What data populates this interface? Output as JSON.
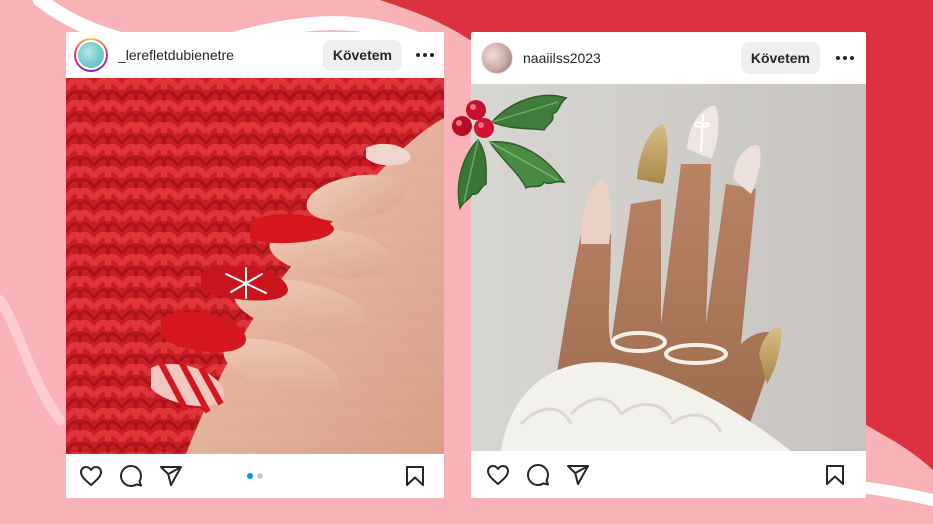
{
  "colors": {
    "background_pink": "#f9b3b8",
    "background_red": "#dc3240",
    "card_white": "#ffffff",
    "text_dark": "#262626",
    "button_gray": "#efefef",
    "dot_active": "#0095f6",
    "dot_inactive": "#c8c8c8"
  },
  "posts": [
    {
      "username": "_lerefletdubienetre",
      "follow_label": "Követem",
      "more_icon": "more-horizontal-icon",
      "image_subject": "red-nails-on-red-knit",
      "actions": [
        "heart-icon",
        "comment-icon",
        "share-icon",
        "bookmark-icon"
      ],
      "carousel": {
        "total": 2,
        "active": 1
      }
    },
    {
      "username": "naaiilss2023",
      "follow_label": "Követem",
      "more_icon": "more-horizontal-icon",
      "image_subject": "nude-gold-glitter-nails",
      "actions": [
        "heart-icon",
        "comment-icon",
        "share-icon",
        "bookmark-icon"
      ]
    }
  ],
  "decoration": "holly-icon"
}
